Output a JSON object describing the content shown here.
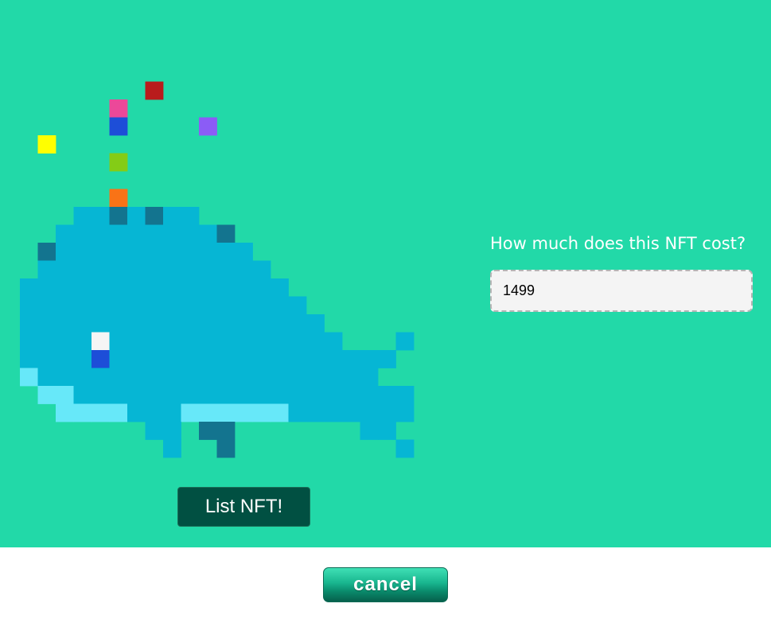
{
  "theme": {
    "background": "#22d9a8",
    "whale_body": "#06b6d4",
    "whale_dark": "#13748f",
    "whale_light": "#67e8f9",
    "list_button_bg": "#015042"
  },
  "pricing": {
    "question": "How much does this NFT cost?",
    "value": "1499"
  },
  "actions": {
    "list_label": "List NFT!",
    "cancel_label": "cancel"
  },
  "nft": {
    "icon": "pixel-whale-icon",
    "grid": [
      "........................",
      "........................",
      "........................",
      "........................",
      "........................",
      "........R...............",
      "......P.................",
      "......B....U............",
      "..Y.....................",
      "......G.................",
      "........................",
      "......O.................",
      "....bbDbDbb.............",
      "...bbbbbbbbbD...........",
      "..Dbbbbbbbbbbb..........",
      "..bbbbbbbbbbbbb.........",
      ".bbbbbbbbbbbbbbb........",
      ".bbbbbbbbbbbbbbbb.......",
      ".bbbbbbbbbbbbbbbbb......",
      ".bbbbWbbbbbbbbbbbbb...b.",
      ".bbbbEbbbbbbbbbbbbbbbb..",
      ".Lbbbbbbbbbbbbbbbbbbb...",
      "..LLbbbbbbbbbbbbbbbbbbb.",
      "...LLLLbbbLLLLLLbbbbbbb.",
      "........bb.DD.......bb..",
      ".........b..D.........b.",
      "........................"
    ],
    "palette": {
      "b": "#06b6d4",
      "D": "#13748f",
      "L": "#67e8f9",
      "W": "#f5f5f5",
      "E": "#1d4ed8",
      "R": "#b91c1c",
      "P": "#ec4899",
      "B": "#1d4ed8",
      "U": "#8b5cf6",
      "Y": "#ffff00",
      "G": "#84cc16",
      "O": "#f97316"
    }
  }
}
